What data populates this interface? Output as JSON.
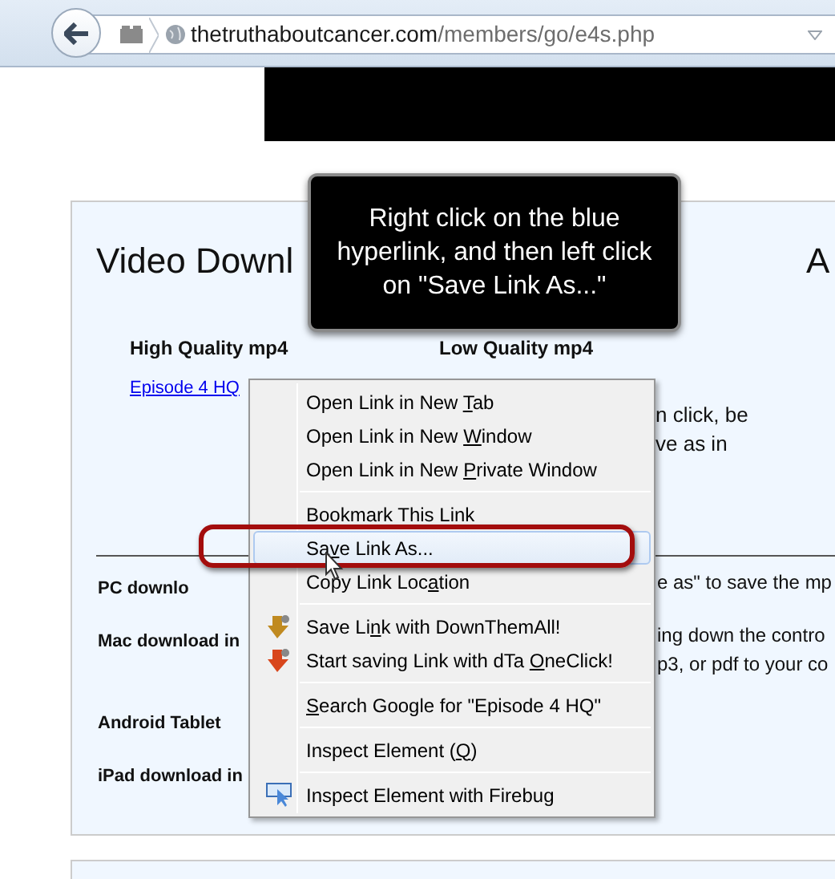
{
  "browser": {
    "url_domain": "thetruthaboutcancer.com",
    "url_path": "/members/go/e4s.php"
  },
  "page": {
    "heading": "Video Downl",
    "heading_right": "A",
    "columns": [
      {
        "title": "High Quality mp4",
        "link": "Episode 4 HQ"
      },
      {
        "title": "Low Quality mp4"
      }
    ],
    "note_lines": [
      "n click, be",
      "ve as in"
    ],
    "instructions": [
      {
        "label": "PC downlo",
        "text": [
          "e as\" to save the mp"
        ]
      },
      {
        "label": "Mac download in",
        "text": [
          "ing down the contro",
          "p3, or pdf to your co"
        ]
      },
      {
        "label": "Android Tablet"
      },
      {
        "label": "iPad download in"
      }
    ]
  },
  "callout": {
    "text": "Right click on the blue hyperlink, and then left click on \"Save Link As...\""
  },
  "context_menu": {
    "items": [
      {
        "kind": "plain",
        "pre": "Open Link in New ",
        "key": "T",
        "post": "ab",
        "selected": false
      },
      {
        "kind": "plain",
        "pre": "Open Link in New ",
        "key": "W",
        "post": "indow",
        "selected": false
      },
      {
        "kind": "plain",
        "pre": "Open Link in New ",
        "key": "P",
        "post": "rivate Window",
        "selected": false
      },
      {
        "kind": "separator"
      },
      {
        "kind": "plain",
        "pre": "Bookmark This Link",
        "selected": false
      },
      {
        "kind": "plain",
        "pre": "Sa",
        "key": "v",
        "post": "e Link As...",
        "selected": true
      },
      {
        "kind": "plain",
        "pre": "Copy Link Loc",
        "key": "a",
        "post": "tion",
        "selected": false
      },
      {
        "kind": "separator"
      },
      {
        "kind": "download",
        "pre": "Save Li",
        "key": "n",
        "post": "k with DownThemAll!",
        "selected": false
      },
      {
        "kind": "download-alt",
        "pre": "Start saving Link with dTa ",
        "key": "O",
        "post": "neClick!",
        "selected": false
      },
      {
        "kind": "separator"
      },
      {
        "kind": "plain",
        "key": "S",
        "post": "earch Google for \"Episode 4 HQ\"",
        "selected": false
      },
      {
        "kind": "separator"
      },
      {
        "kind": "plain",
        "pre": "Inspect Element (",
        "key": "Q",
        "post": ")",
        "selected": false
      },
      {
        "kind": "separator"
      },
      {
        "kind": "inspect",
        "pre": "Inspect Element with Firebug",
        "selected": false
      }
    ]
  }
}
